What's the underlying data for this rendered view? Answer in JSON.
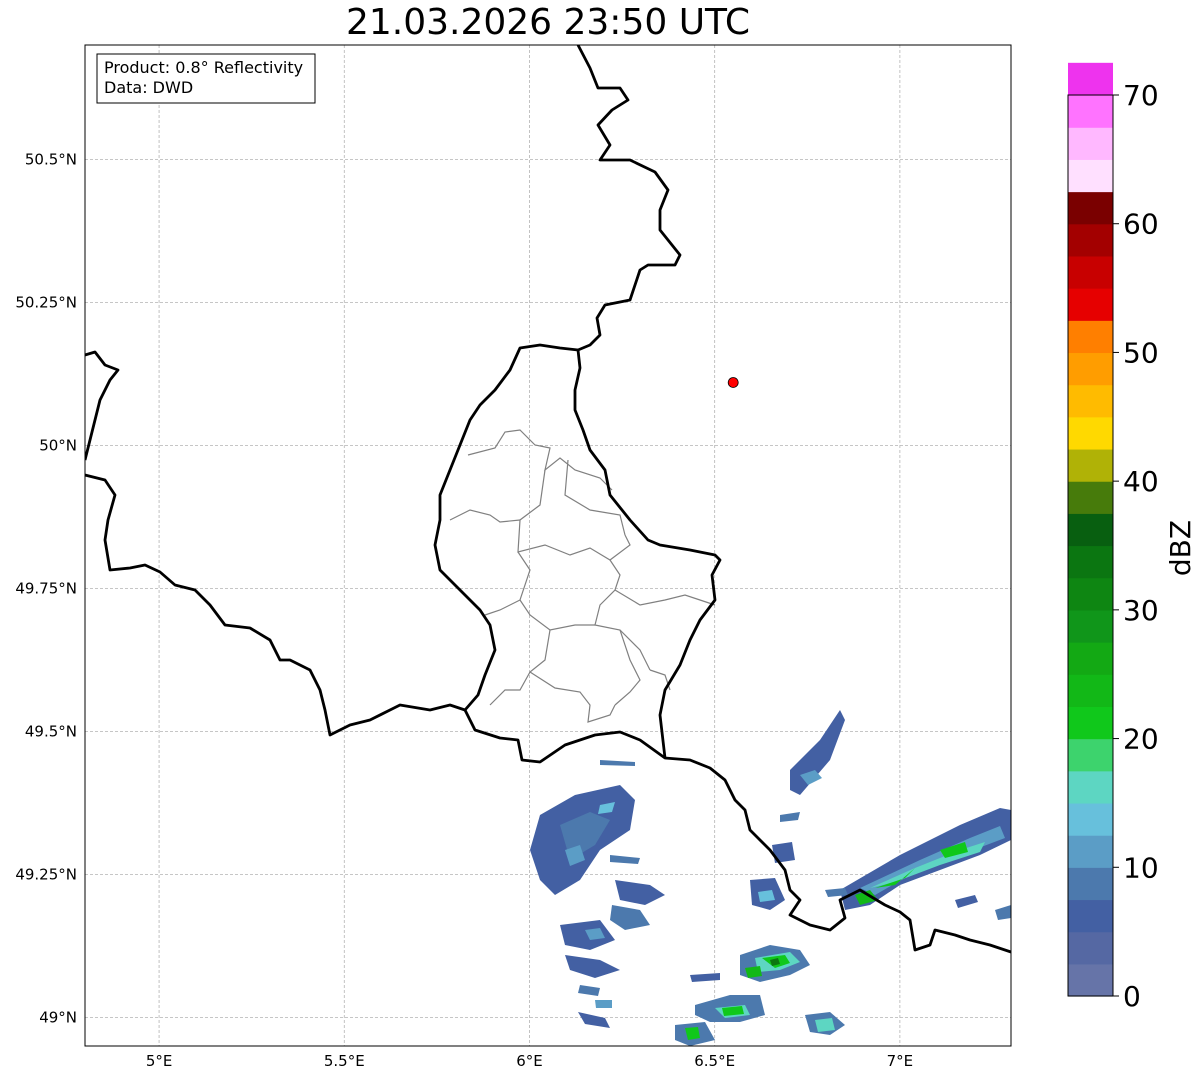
{
  "title": "21.03.2026 23:50 UTC",
  "info": {
    "product": "Product: 0.8° Reflectivity",
    "source": "Data: DWD"
  },
  "map": {
    "lon_range": [
      4.8,
      7.3
    ],
    "lat_range": [
      48.95,
      50.7
    ],
    "x_ticks": [
      {
        "value": 5.0,
        "label": "5°E"
      },
      {
        "value": 5.5,
        "label": "5.5°E"
      },
      {
        "value": 6.0,
        "label": "6°E"
      },
      {
        "value": 6.5,
        "label": "6.5°E"
      },
      {
        "value": 7.0,
        "label": "7°E"
      }
    ],
    "y_ticks": [
      {
        "value": 49.0,
        "label": "49°N"
      },
      {
        "value": 49.25,
        "label": "49.25°N"
      },
      {
        "value": 49.5,
        "label": "49.5°N"
      },
      {
        "value": 49.75,
        "label": "49.75°N"
      },
      {
        "value": 50.0,
        "label": "50°N"
      },
      {
        "value": 50.25,
        "label": "50.25°N"
      },
      {
        "value": 50.5,
        "label": "50.5°N"
      }
    ],
    "gridlines": true,
    "marker": {
      "lon": 6.55,
      "lat": 50.11,
      "color": "#ff0000"
    }
  },
  "colorbar": {
    "label": "dBZ",
    "min": 0,
    "max": 70,
    "tick_labels": [
      "0",
      "10",
      "20",
      "30",
      "40",
      "50",
      "60",
      "70"
    ],
    "colors": [
      "#6674a8",
      "#5568a3",
      "#4360a3",
      "#4c79ad",
      "#5b9dc6",
      "#67c0dc",
      "#5dd6c2",
      "#3dd36d",
      "#10c81b",
      "#12b817",
      "#13a914",
      "#10961a",
      "#0e8612",
      "#0b7611",
      "#085f10",
      "#477b0b",
      "#b0b206",
      "#ffd900",
      "#ffbb00",
      "#ff9d00",
      "#ff7f00",
      "#e60000",
      "#c80000",
      "#a30000",
      "#7a0000",
      "#ffe0ff",
      "#ffb8ff",
      "#ff73ff",
      "#ee33ee"
    ]
  }
}
